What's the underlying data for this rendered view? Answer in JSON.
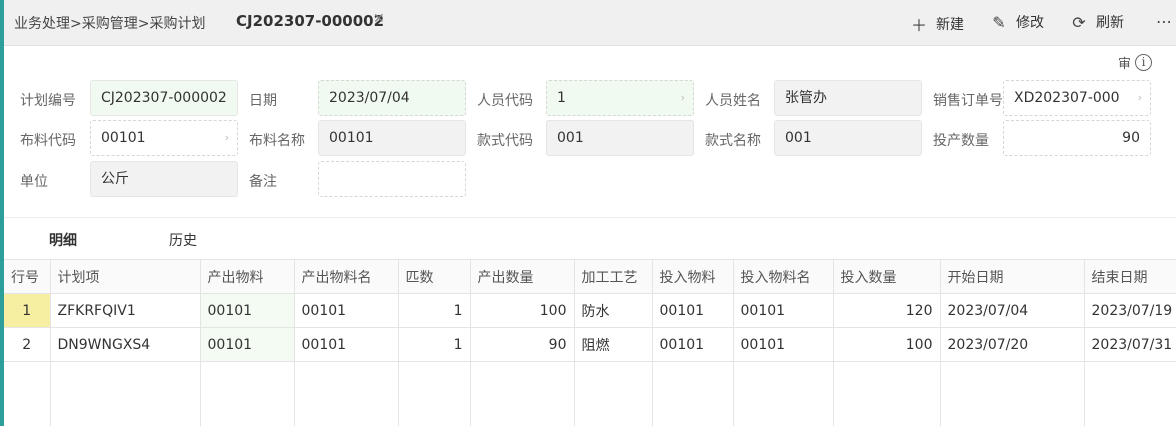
{
  "breadcrumb": "业务处理>采购管理>采购计划",
  "document_tab": "CJ202307-000002",
  "toolbar": {
    "new_label": "新建",
    "edit_label": "修改",
    "refresh_label": "刷新"
  },
  "audit_label": "审",
  "form": {
    "plan_no_label": "计划编号",
    "plan_no": "CJ202307-000002",
    "date_label": "日期",
    "date": "2023/07/04",
    "staff_code_label": "人员代码",
    "staff_code": "1",
    "staff_name_label": "人员姓名",
    "staff_name": "张管办",
    "sales_order_label": "销售订单号",
    "sales_order": "XD202307-000",
    "fabric_code_label": "布料代码",
    "fabric_code": "00101",
    "fabric_name_label": "布料名称",
    "fabric_name": "00101",
    "style_code_label": "款式代码",
    "style_code": "001",
    "style_name_label": "款式名称",
    "style_name": "001",
    "prod_qty_label": "投产数量",
    "prod_qty": "90",
    "unit_label": "单位",
    "unit": "公斤",
    "remark_label": "备注",
    "remark": ""
  },
  "subtabs": {
    "detail": "明细",
    "history": "历史"
  },
  "table": {
    "headers": [
      "行号",
      "计划项",
      "产出物料",
      "产出物料名",
      "匹数",
      "产出数量",
      "加工工艺",
      "投入物料",
      "投入物料名",
      "投入数量",
      "开始日期",
      "结束日期"
    ],
    "rows": [
      [
        "1",
        "ZFKRFQIV1",
        "00101",
        "00101",
        "1",
        "100",
        "防水",
        "00101",
        "00101",
        "120",
        "2023/07/04",
        "2023/07/19"
      ],
      [
        "2",
        "DN9WNGXS4",
        "00101",
        "00101",
        "1",
        "90",
        "阻燃",
        "00101",
        "00101",
        "100",
        "2023/07/20",
        "2023/07/31"
      ]
    ]
  }
}
